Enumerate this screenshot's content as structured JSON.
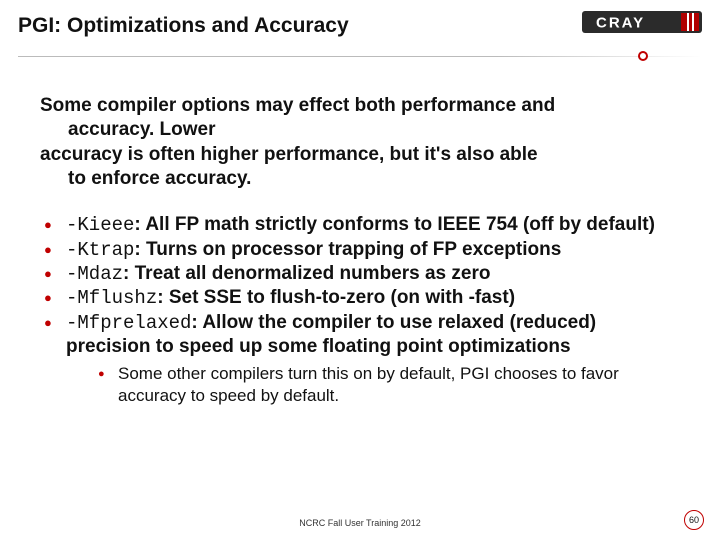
{
  "logo_text": "CRAY",
  "title": "PGI: Optimizations and Accuracy",
  "intro": {
    "l1": "Some compiler options may effect both performance and",
    "l2": "accuracy.  Lower",
    "l3a": "accuracy is often higher performance, but it's also able",
    "l3b": "to enforce accuracy."
  },
  "bullets": [
    {
      "flag": "-Kieee",
      "desc": ": All FP math strictly conforms to IEEE 754 (off by default)"
    },
    {
      "flag": "-Ktrap",
      "desc": ": Turns on processor trapping of FP exceptions"
    },
    {
      "flag": "-Mdaz",
      "desc": ": Treat all denormalized numbers as zero"
    },
    {
      "flag": "-Mflushz",
      "desc": ": Set SSE to flush-to-zero (on with -fast)"
    },
    {
      "flag": "-Mfprelaxed",
      "desc": ": Allow the compiler to use relaxed (reduced) precision to speed up some floating point optimizations"
    }
  ],
  "subbullet": "Some other compilers turn this on by default, PGI chooses to favor accuracy to speed by default.",
  "footer": "NCRC Fall User Training 2012",
  "page": "60"
}
